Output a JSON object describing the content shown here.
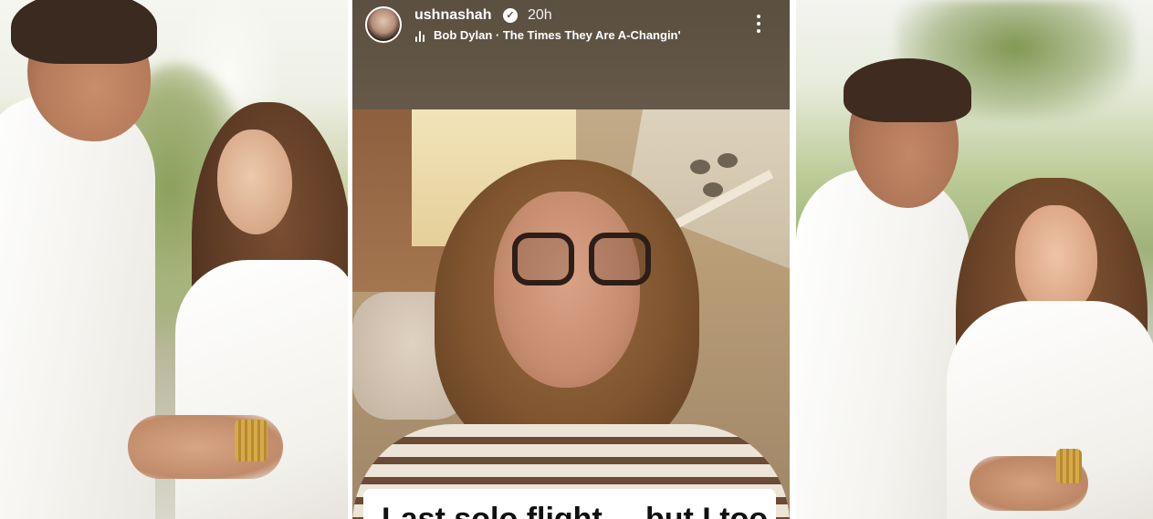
{
  "story": {
    "username": "ushnashah",
    "verified_icon": "check-badge-icon",
    "time": "20h",
    "music": "Bob Dylan · The Times They Are A-Changin'",
    "music_icon": "sound-bars-icon",
    "more_icon": "vertical-dots-icon",
    "caption": "Last solo flight ... but I too"
  },
  "colors": {
    "story_background": "#5e5141",
    "header_text": "#ffffff",
    "caption_background": "#ffffff",
    "caption_text": "#111111"
  }
}
